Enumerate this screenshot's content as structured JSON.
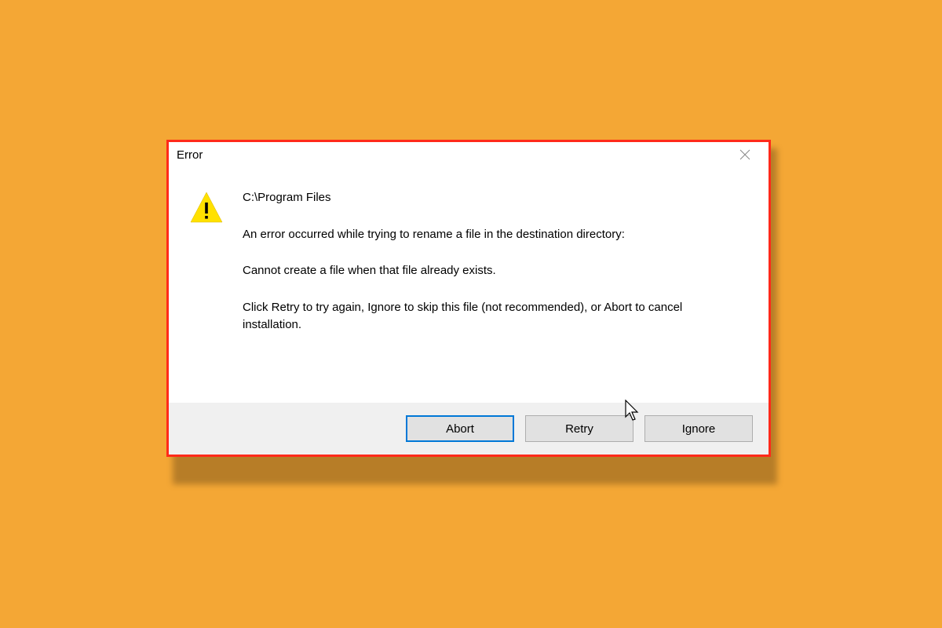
{
  "dialog": {
    "title": "Error",
    "path": "C:\\Program Files",
    "message_line1": "An error occurred while trying to rename a file in the destination directory:",
    "message_line2": "Cannot create a file when that file already exists.",
    "message_line3": "Click Retry to try again, Ignore to skip this file (not recommended), or Abort to cancel installation.",
    "buttons": {
      "abort": "Abort",
      "retry": "Retry",
      "ignore": "Ignore"
    }
  }
}
